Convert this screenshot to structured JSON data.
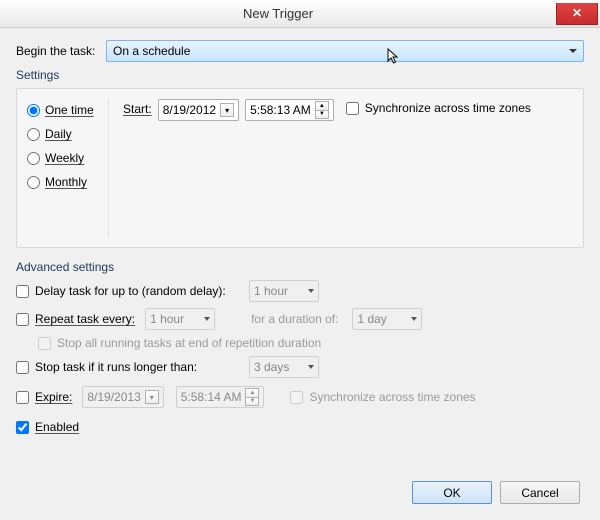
{
  "window": {
    "title": "New Trigger",
    "close_glyph": "✕"
  },
  "begin": {
    "label": "Begin the task:",
    "value": "On a schedule"
  },
  "settings": {
    "label": "Settings",
    "frequencies": {
      "one_time": "One time",
      "daily": "Daily",
      "weekly": "Weekly",
      "monthly": "Monthly",
      "selected": "one_time"
    },
    "start_label": "Start:",
    "start_date": "8/19/2012",
    "start_time": "5:58:13 AM",
    "sync_label": "Synchronize across time zones"
  },
  "advanced": {
    "label": "Advanced settings",
    "delay": {
      "label": "Delay task for up to (random delay):",
      "value": "1 hour"
    },
    "repeat": {
      "label": "Repeat task every:",
      "value": "1 hour",
      "duration_label": "for a duration of:",
      "duration_value": "1 day"
    },
    "stop_repeat": "Stop all running tasks at end of repetition duration",
    "stop_long": {
      "label": "Stop task if it runs longer than:",
      "value": "3 days"
    },
    "expire": {
      "label": "Expire:",
      "date": "8/19/2013",
      "time": "5:58:14 AM",
      "sync_label": "Synchronize across time zones"
    },
    "enabled": "Enabled"
  },
  "buttons": {
    "ok": "OK",
    "cancel": "Cancel"
  }
}
